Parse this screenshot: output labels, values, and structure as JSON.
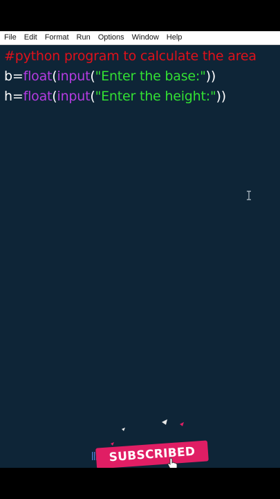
{
  "menu": {
    "items": [
      "File",
      "Edit",
      "Format",
      "Run",
      "Options",
      "Window",
      "Help"
    ]
  },
  "code": {
    "line1": {
      "comment": "#python program to calculate the area"
    },
    "line2": {
      "var": "b",
      "eq": "=",
      "fn1": "float",
      "p1": "(",
      "fn2": "input",
      "p2": "(",
      "str": "\"Enter the base:\"",
      "close": "))"
    },
    "line3": {
      "var": "h",
      "eq": "=",
      "fn1": "float",
      "p1": "(",
      "fn2": "input",
      "p2": "(",
      "str": "\"Enter the height:\"",
      "close": "))"
    }
  },
  "overlay": {
    "badge_text": "SUBSCRIBED"
  },
  "colors": {
    "editor_bg": "#0e2537",
    "comment": "#e0111b",
    "builtin": "#b43ce0",
    "string": "#33e033",
    "badge": "#e01e64"
  },
  "icons": [
    "text-cursor-icon",
    "hand-pointer-icon"
  ]
}
